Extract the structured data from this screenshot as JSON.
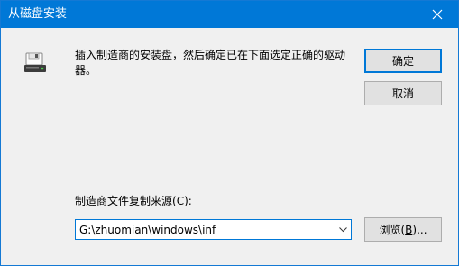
{
  "window": {
    "title": "从磁盘安装",
    "accent_color": "#0078d7"
  },
  "message": "插入制造商的安装盘，然后确定已在下面选定正确的驱动器。",
  "buttons": {
    "ok_label": "确定",
    "cancel_label": "取消",
    "browse_label_prefix": "浏览(",
    "browse_hotkey": "B",
    "browse_label_suffix": ")..."
  },
  "source": {
    "label_prefix": "制造商文件复制来源(",
    "label_hotkey": "C",
    "label_suffix": "):",
    "value": "G:\\zhuomian\\windows\\inf"
  },
  "icons": {
    "window_close": "close-icon",
    "disk": "floppy-disk-icon",
    "dropdown": "chevron-down-icon"
  }
}
